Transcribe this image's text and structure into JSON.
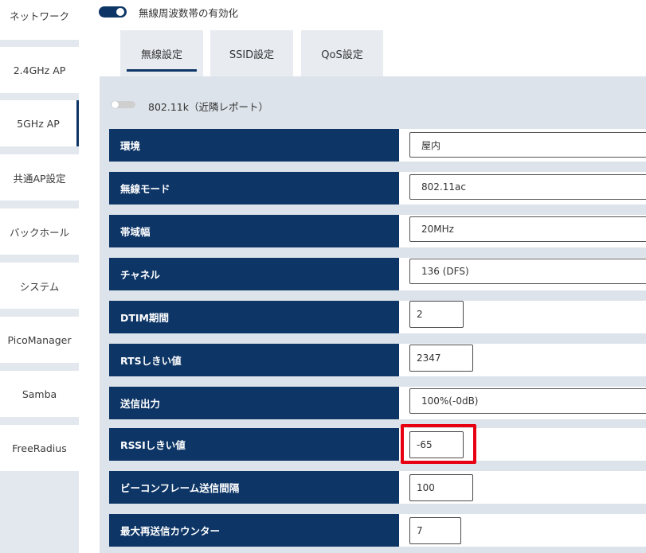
{
  "sidebar": {
    "items": [
      {
        "label": "ネットワーク",
        "active": false
      },
      {
        "label": "2.4GHz AP",
        "active": false
      },
      {
        "label": "5GHz AP",
        "active": true
      },
      {
        "label": "共通AP設定",
        "active": false
      },
      {
        "label": "バックホール",
        "active": false
      },
      {
        "label": "システム",
        "active": false
      },
      {
        "label": "PicoManager",
        "active": false
      },
      {
        "label": "Samba",
        "active": false
      },
      {
        "label": "FreeRadius",
        "active": false
      }
    ]
  },
  "header": {
    "band_toggle_label": "無線周波数帯の有効化",
    "band_toggle_on": true
  },
  "tabs": [
    {
      "label": "無線設定",
      "selected": true
    },
    {
      "label": "SSID設定",
      "selected": false
    },
    {
      "label": "QoS設定",
      "selected": false
    }
  ],
  "neighbor_report": {
    "label": "802.11k（近隣レポート）",
    "enabled": false
  },
  "settings": [
    {
      "label": "環境",
      "value": "屋内",
      "kind": "select"
    },
    {
      "label": "無線モード",
      "value": "802.11ac",
      "kind": "select"
    },
    {
      "label": "帯域幅",
      "value": "20MHz",
      "kind": "select"
    },
    {
      "label": "チャネル",
      "value": "136 (DFS)",
      "kind": "select"
    },
    {
      "label": "DTIM期間",
      "value": "2",
      "kind": "input"
    },
    {
      "label": "RTSしきい値",
      "value": "2347",
      "kind": "input"
    },
    {
      "label": "送信出力",
      "value": "100%(-0dB)",
      "kind": "select"
    },
    {
      "label": "RSSIしきい値",
      "value": "-65",
      "kind": "input",
      "highlighted": true
    },
    {
      "label": "ビーコンフレーム送信間隔",
      "value": "100",
      "kind": "input"
    },
    {
      "label": "最大再送信カウンター",
      "value": "7",
      "kind": "input"
    }
  ],
  "colors": {
    "label_bg": "#0d3566",
    "panel_bg": "#dde3ea",
    "highlight": "#e60012"
  }
}
